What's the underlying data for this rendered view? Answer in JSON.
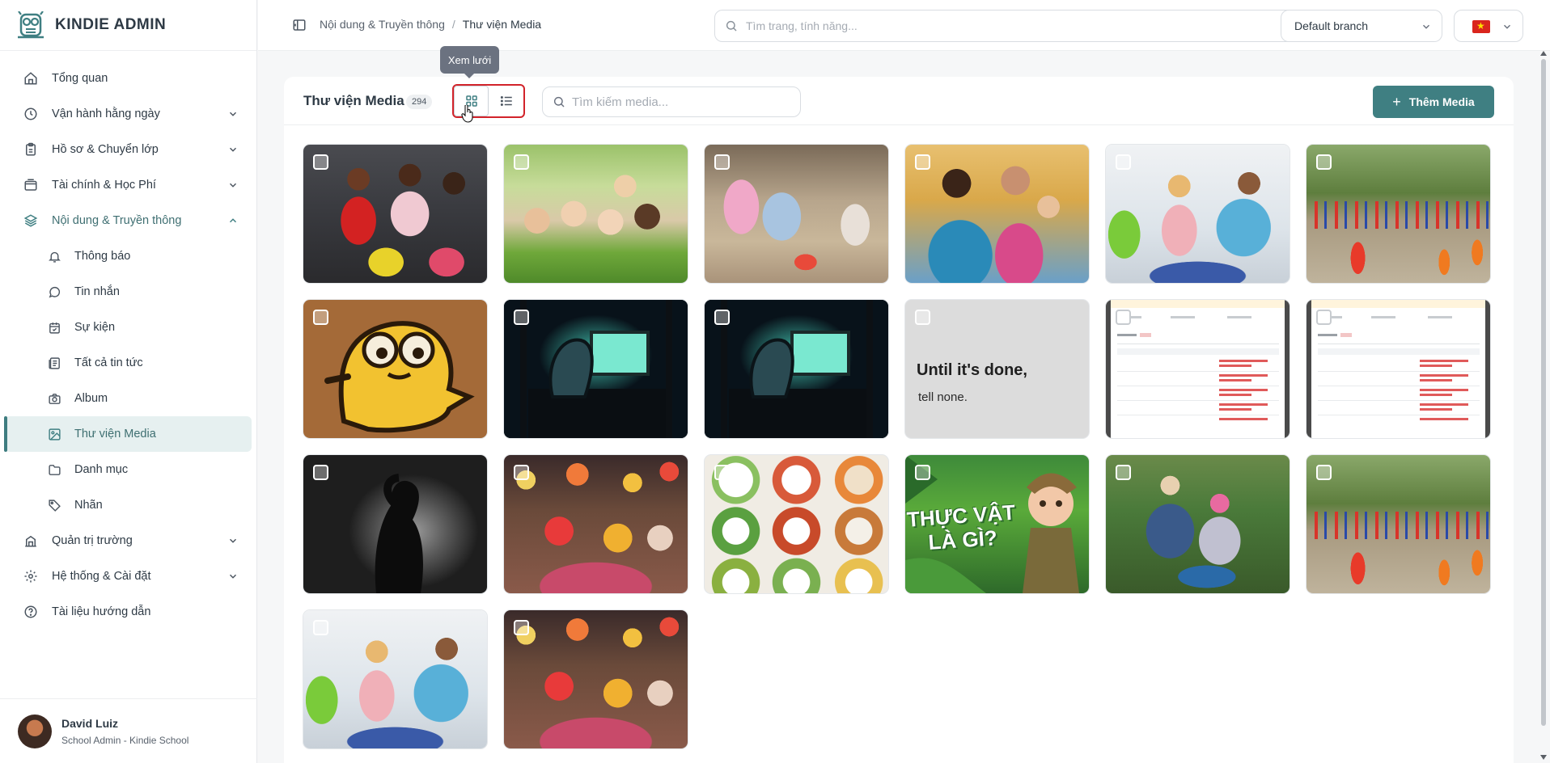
{
  "brand": {
    "name": "KINDIE ADMIN",
    "color": "#3f7f82"
  },
  "sidebar": {
    "items": [
      {
        "label": "Tổng quan",
        "icon": "home-icon"
      },
      {
        "label": "Vận hành hằng ngày",
        "icon": "clock-icon"
      },
      {
        "label": "Hồ sơ & Chuyển lớp",
        "icon": "clipboard-icon"
      },
      {
        "label": "Tài chính & Học Phí",
        "icon": "wallet-icon"
      },
      {
        "label": "Nội dung & Truyền thông",
        "icon": "layers-icon"
      },
      {
        "label": "Quản trị trường",
        "icon": "building-icon"
      },
      {
        "label": "Hệ thống & Cài đặt",
        "icon": "gear-icon"
      },
      {
        "label": "Tài liệu hướng dẫn",
        "icon": "help-icon"
      }
    ],
    "sub_items": [
      {
        "label": "Thông báo",
        "icon": "bell-icon"
      },
      {
        "label": "Tin nhắn",
        "icon": "chat-icon"
      },
      {
        "label": "Sự kiện",
        "icon": "calendar-icon"
      },
      {
        "label": "Tất cả tin tức",
        "icon": "news-icon"
      },
      {
        "label": "Album",
        "icon": "camera-icon"
      },
      {
        "label": "Thư viện Media",
        "icon": "image-icon"
      },
      {
        "label": "Danh mục",
        "icon": "folder-icon"
      },
      {
        "label": "Nhãn",
        "icon": "tag-icon"
      }
    ]
  },
  "user": {
    "name": "David Luiz",
    "role": "School Admin - Kindie School"
  },
  "header": {
    "breadcrumb": [
      "Nội dung & Truyền thông",
      "/",
      "Thư viện Media"
    ],
    "search_placeholder": "Tìm trang, tính năng...",
    "branch": "Default branch"
  },
  "media": {
    "title": "Thư viện Media",
    "count": "294",
    "tooltip": "Xem lưới",
    "search_placeholder": "Tìm kiếm media...",
    "add_label": "Thêm Media",
    "tiles": [
      {
        "kind": "photo-kids-bouncing"
      },
      {
        "kind": "photo-kids-grass"
      },
      {
        "kind": "photo-kids-sandbox"
      },
      {
        "kind": "photo-kids-hug"
      },
      {
        "kind": "photo-teacher-reading"
      },
      {
        "kind": "photo-kids-race"
      },
      {
        "kind": "illustration-yellow-dog"
      },
      {
        "kind": "illustration-dark-computer"
      },
      {
        "kind": "illustration-dark-computer"
      },
      {
        "kind": "text-card",
        "line1": "Until it's done,",
        "line2": "tell none."
      },
      {
        "kind": "screenshot-import-report"
      },
      {
        "kind": "screenshot-import-report"
      },
      {
        "kind": "photo-silhouette-bw"
      },
      {
        "kind": "photo-lantern-festival"
      },
      {
        "kind": "photo-food-plates"
      },
      {
        "kind": "illustration-plants",
        "text": "THỰC VẬT LÀ GÌ?"
      },
      {
        "kind": "photo-kids-garden"
      },
      {
        "kind": "photo-kids-race"
      },
      {
        "kind": "photo-teacher-reading"
      },
      {
        "kind": "photo-lantern-festival"
      }
    ]
  }
}
